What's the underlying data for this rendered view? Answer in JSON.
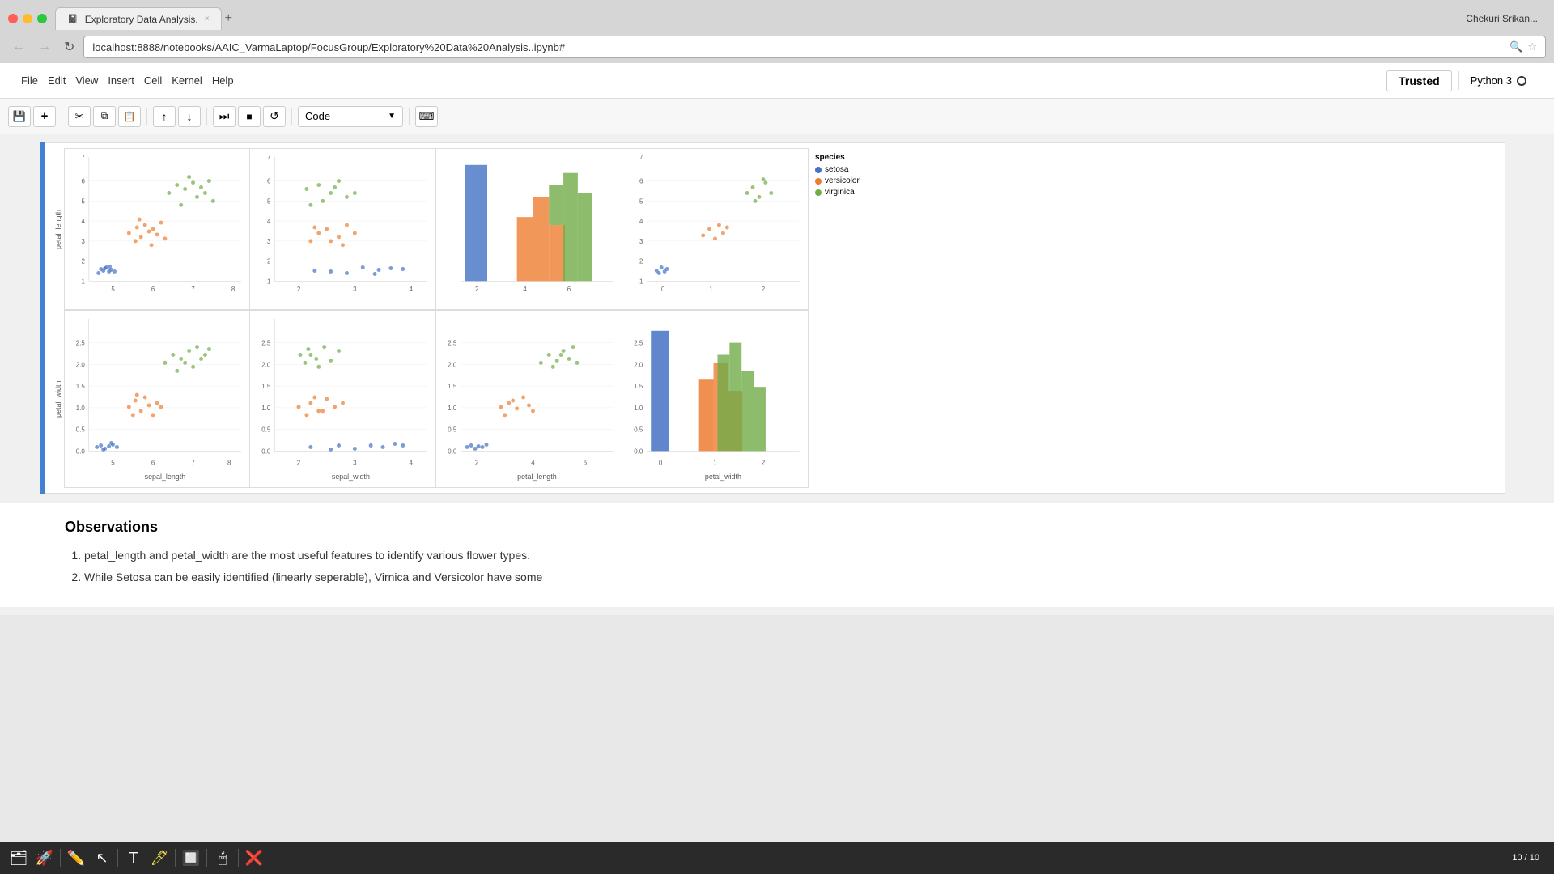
{
  "browser": {
    "tab_title": "Exploratory Data Analysis.",
    "url": "localhost:8888/notebooks/AAIC_VarmaLaptop/FocusGroup/Exploratory%20Data%20Analysis..ipynb#",
    "new_tab_button": "+",
    "tab_close": "×"
  },
  "nav": {
    "back_btn": "←",
    "forward_btn": "→",
    "refresh_btn": "↻",
    "search_icon": "🔍",
    "bookmark_icon": "☆"
  },
  "jupyter": {
    "menu_items": [
      "File",
      "Edit",
      "View",
      "Insert",
      "Cell",
      "Kernel",
      "Help"
    ],
    "trusted_label": "Trusted",
    "kernel_label": "Python 3",
    "cell_type": "Code"
  },
  "toolbar_buttons": [
    {
      "name": "save",
      "icon": "💾"
    },
    {
      "name": "add-cell",
      "icon": "+"
    },
    {
      "name": "cut",
      "icon": "✂"
    },
    {
      "name": "copy",
      "icon": "⧉"
    },
    {
      "name": "paste",
      "icon": "📋"
    },
    {
      "name": "move-up",
      "icon": "↑"
    },
    {
      "name": "move-down",
      "icon": "↓"
    },
    {
      "name": "run-next",
      "icon": "⏭"
    },
    {
      "name": "stop",
      "icon": "■"
    },
    {
      "name": "restart",
      "icon": "↺"
    },
    {
      "name": "keyboard",
      "icon": "⌨"
    }
  ],
  "legend": {
    "title": "species",
    "items": [
      {
        "label": "setosa",
        "color": "#4472c4"
      },
      {
        "label": "versicolor",
        "color": "#ed7d31"
      },
      {
        "label": "virginica",
        "color": "#70ad47"
      }
    ]
  },
  "observations": {
    "title": "Observations",
    "items": [
      "petal_length and petal_width are the most useful features to identify various flower types.",
      "While Setosa can be easily identified (linearly seperable), Virnica and Versicolor have some"
    ]
  },
  "axes": {
    "row1_ylabels": [
      "7",
      "6",
      "5",
      "4",
      "3",
      "2",
      "1"
    ],
    "row1_ylabel": "petal_length",
    "row2_ylabels": [
      "2.5",
      "2.0",
      "1.5",
      "1.0",
      "0.5",
      "0.0"
    ],
    "row2_ylabel": "petal_width",
    "row1_xlabels": [
      [
        "5",
        "6",
        "7",
        "8"
      ],
      [
        "2",
        "3",
        "4"
      ],
      [
        "2",
        "4",
        "6"
      ],
      [
        "0",
        "1",
        "2"
      ]
    ],
    "row2_xlabels": [
      [
        "5",
        "6",
        "7",
        "8"
      ],
      [
        "2",
        "3",
        "4"
      ],
      [
        "2",
        "4",
        "6"
      ],
      [
        "0",
        "1",
        "2"
      ]
    ],
    "row2_xaxis_labels": [
      "sepal_length",
      "sepal_width",
      "petal_length",
      "petal_width"
    ]
  },
  "taskbar_page": "10 / 10",
  "user_name": "Chekuri Srikan..."
}
